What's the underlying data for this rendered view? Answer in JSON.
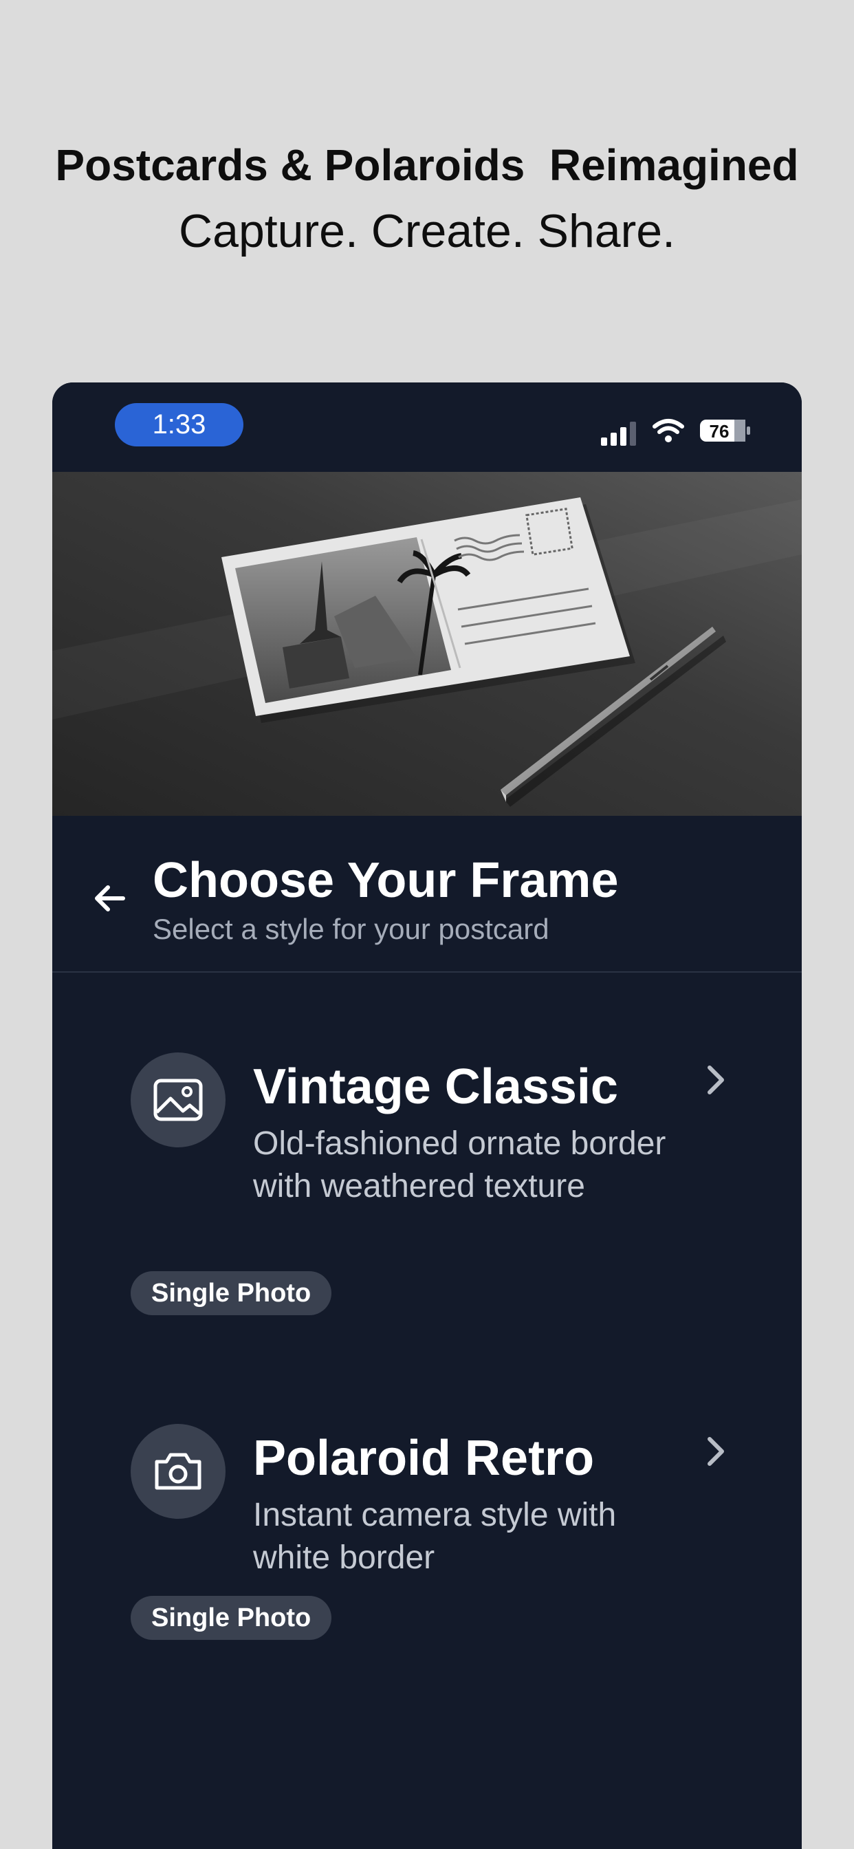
{
  "promo": {
    "headline": "Postcards & Polaroids  Reimagined",
    "tagline": "Capture. Create. Share."
  },
  "status_bar": {
    "time": "1:33",
    "battery": "76"
  },
  "header": {
    "title": "Choose Your Frame",
    "subtitle": "Select a style for your postcard"
  },
  "frames": [
    {
      "title": "Vintage Classic",
      "description": "Old-fashioned ornate border with weathered texture",
      "badge": "Single Photo",
      "icon": "image-icon"
    },
    {
      "title": "Polaroid Retro",
      "description": "Instant camera style with white border",
      "badge": "Single Photo",
      "icon": "camera-icon"
    }
  ],
  "colors": {
    "background": "#dcdcdc",
    "app_background": "#131a2a",
    "accent_pill": "#2a64d6",
    "icon_circle": "#3a4150"
  }
}
